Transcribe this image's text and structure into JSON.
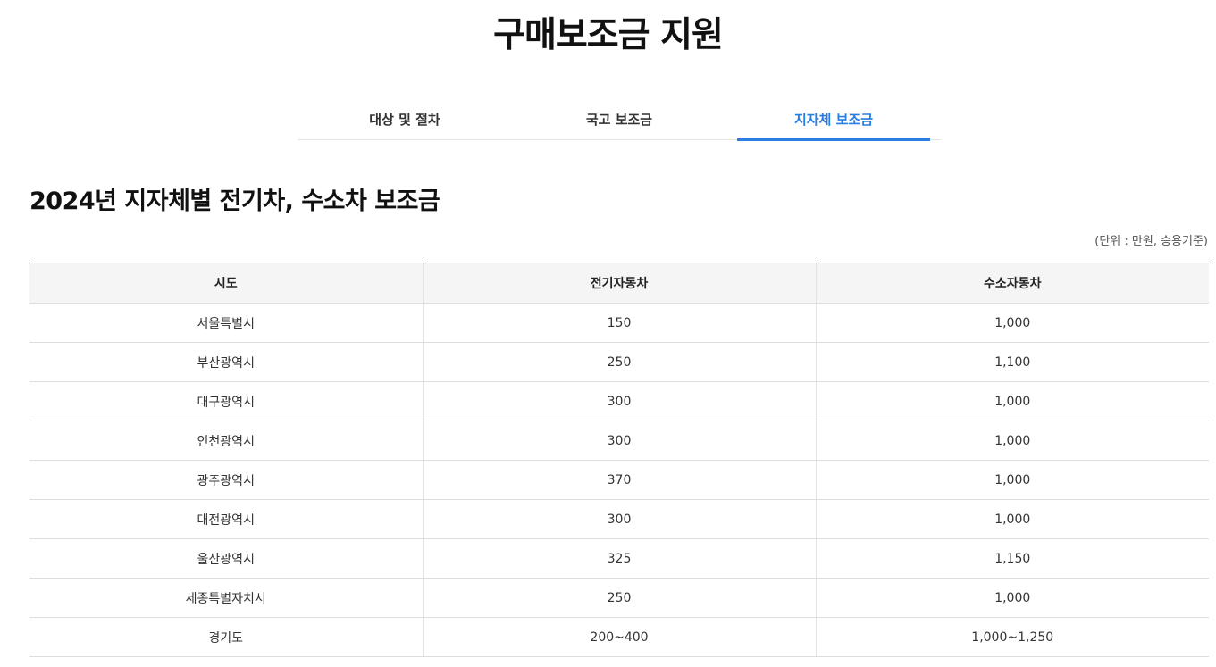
{
  "page": {
    "title": "구매보조금 지원"
  },
  "tabs": [
    {
      "label": "대상 및 절차",
      "active": false
    },
    {
      "label": "국고 보조금",
      "active": false
    },
    {
      "label": "지자체 보조금",
      "active": true
    }
  ],
  "colors": {
    "accent": "#2a7de1",
    "header_bg": "#f5f5f5"
  },
  "section": {
    "title": "2024년 지자체별 전기차, 수소차 보조금",
    "unit_note": "(단위 : 만원, 승용기준)"
  },
  "table": {
    "headers": [
      "시도",
      "전기자동차",
      "수소자동차"
    ],
    "rows": [
      [
        "서울특별시",
        "150",
        "1,000"
      ],
      [
        "부산광역시",
        "250",
        "1,100"
      ],
      [
        "대구광역시",
        "300",
        "1,000"
      ],
      [
        "인천광역시",
        "300",
        "1,000"
      ],
      [
        "광주광역시",
        "370",
        "1,000"
      ],
      [
        "대전광역시",
        "300",
        "1,000"
      ],
      [
        "울산광역시",
        "325",
        "1,150"
      ],
      [
        "세종특별자치시",
        "250",
        "1,000"
      ],
      [
        "경기도",
        "200~400",
        "1,000~1,250"
      ]
    ]
  }
}
